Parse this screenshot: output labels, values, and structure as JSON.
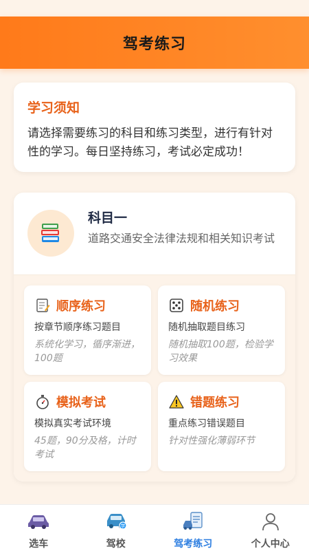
{
  "header": {
    "title": "驾考练习"
  },
  "notice": {
    "title": "学习须知",
    "text": "请选择需要练习的科目和练习类型，进行有针对性的学习。每日坚持练习，考试必定成功！"
  },
  "subject": {
    "name": "科目一",
    "desc": "道路交通安全法律法规和相关知识考试",
    "icon": "books-icon"
  },
  "practice_cards": [
    {
      "title": "顺序练习",
      "desc": "按章节顺序练习题目",
      "sub": "系统化学习，循序渐进，100题",
      "icon": "memo-icon"
    },
    {
      "title": "随机练习",
      "desc": "随机抽取题目练习",
      "sub": "随机抽取100题，检验学习效果",
      "icon": "dice-icon"
    },
    {
      "title": "模拟考试",
      "desc": "模拟真实考试环境",
      "sub": "45题，90分及格，计时考试",
      "icon": "stopwatch-icon"
    },
    {
      "title": "错题练习",
      "desc": "重点练习错误题目",
      "sub": "针对性强化薄弱环节",
      "icon": "warning-icon"
    }
  ],
  "tabbar": {
    "items": [
      {
        "label": "选车",
        "icon": "car-icon",
        "active": false
      },
      {
        "label": "驾校",
        "icon": "school-car-icon",
        "active": false
      },
      {
        "label": "驾考练习",
        "icon": "practice-icon",
        "active": true
      },
      {
        "label": "个人中心",
        "icon": "user-icon",
        "active": false
      }
    ]
  },
  "colors": {
    "accent": "#ff7a1a",
    "title_orange": "#e8621a",
    "tab_active": "#2b7de0"
  }
}
